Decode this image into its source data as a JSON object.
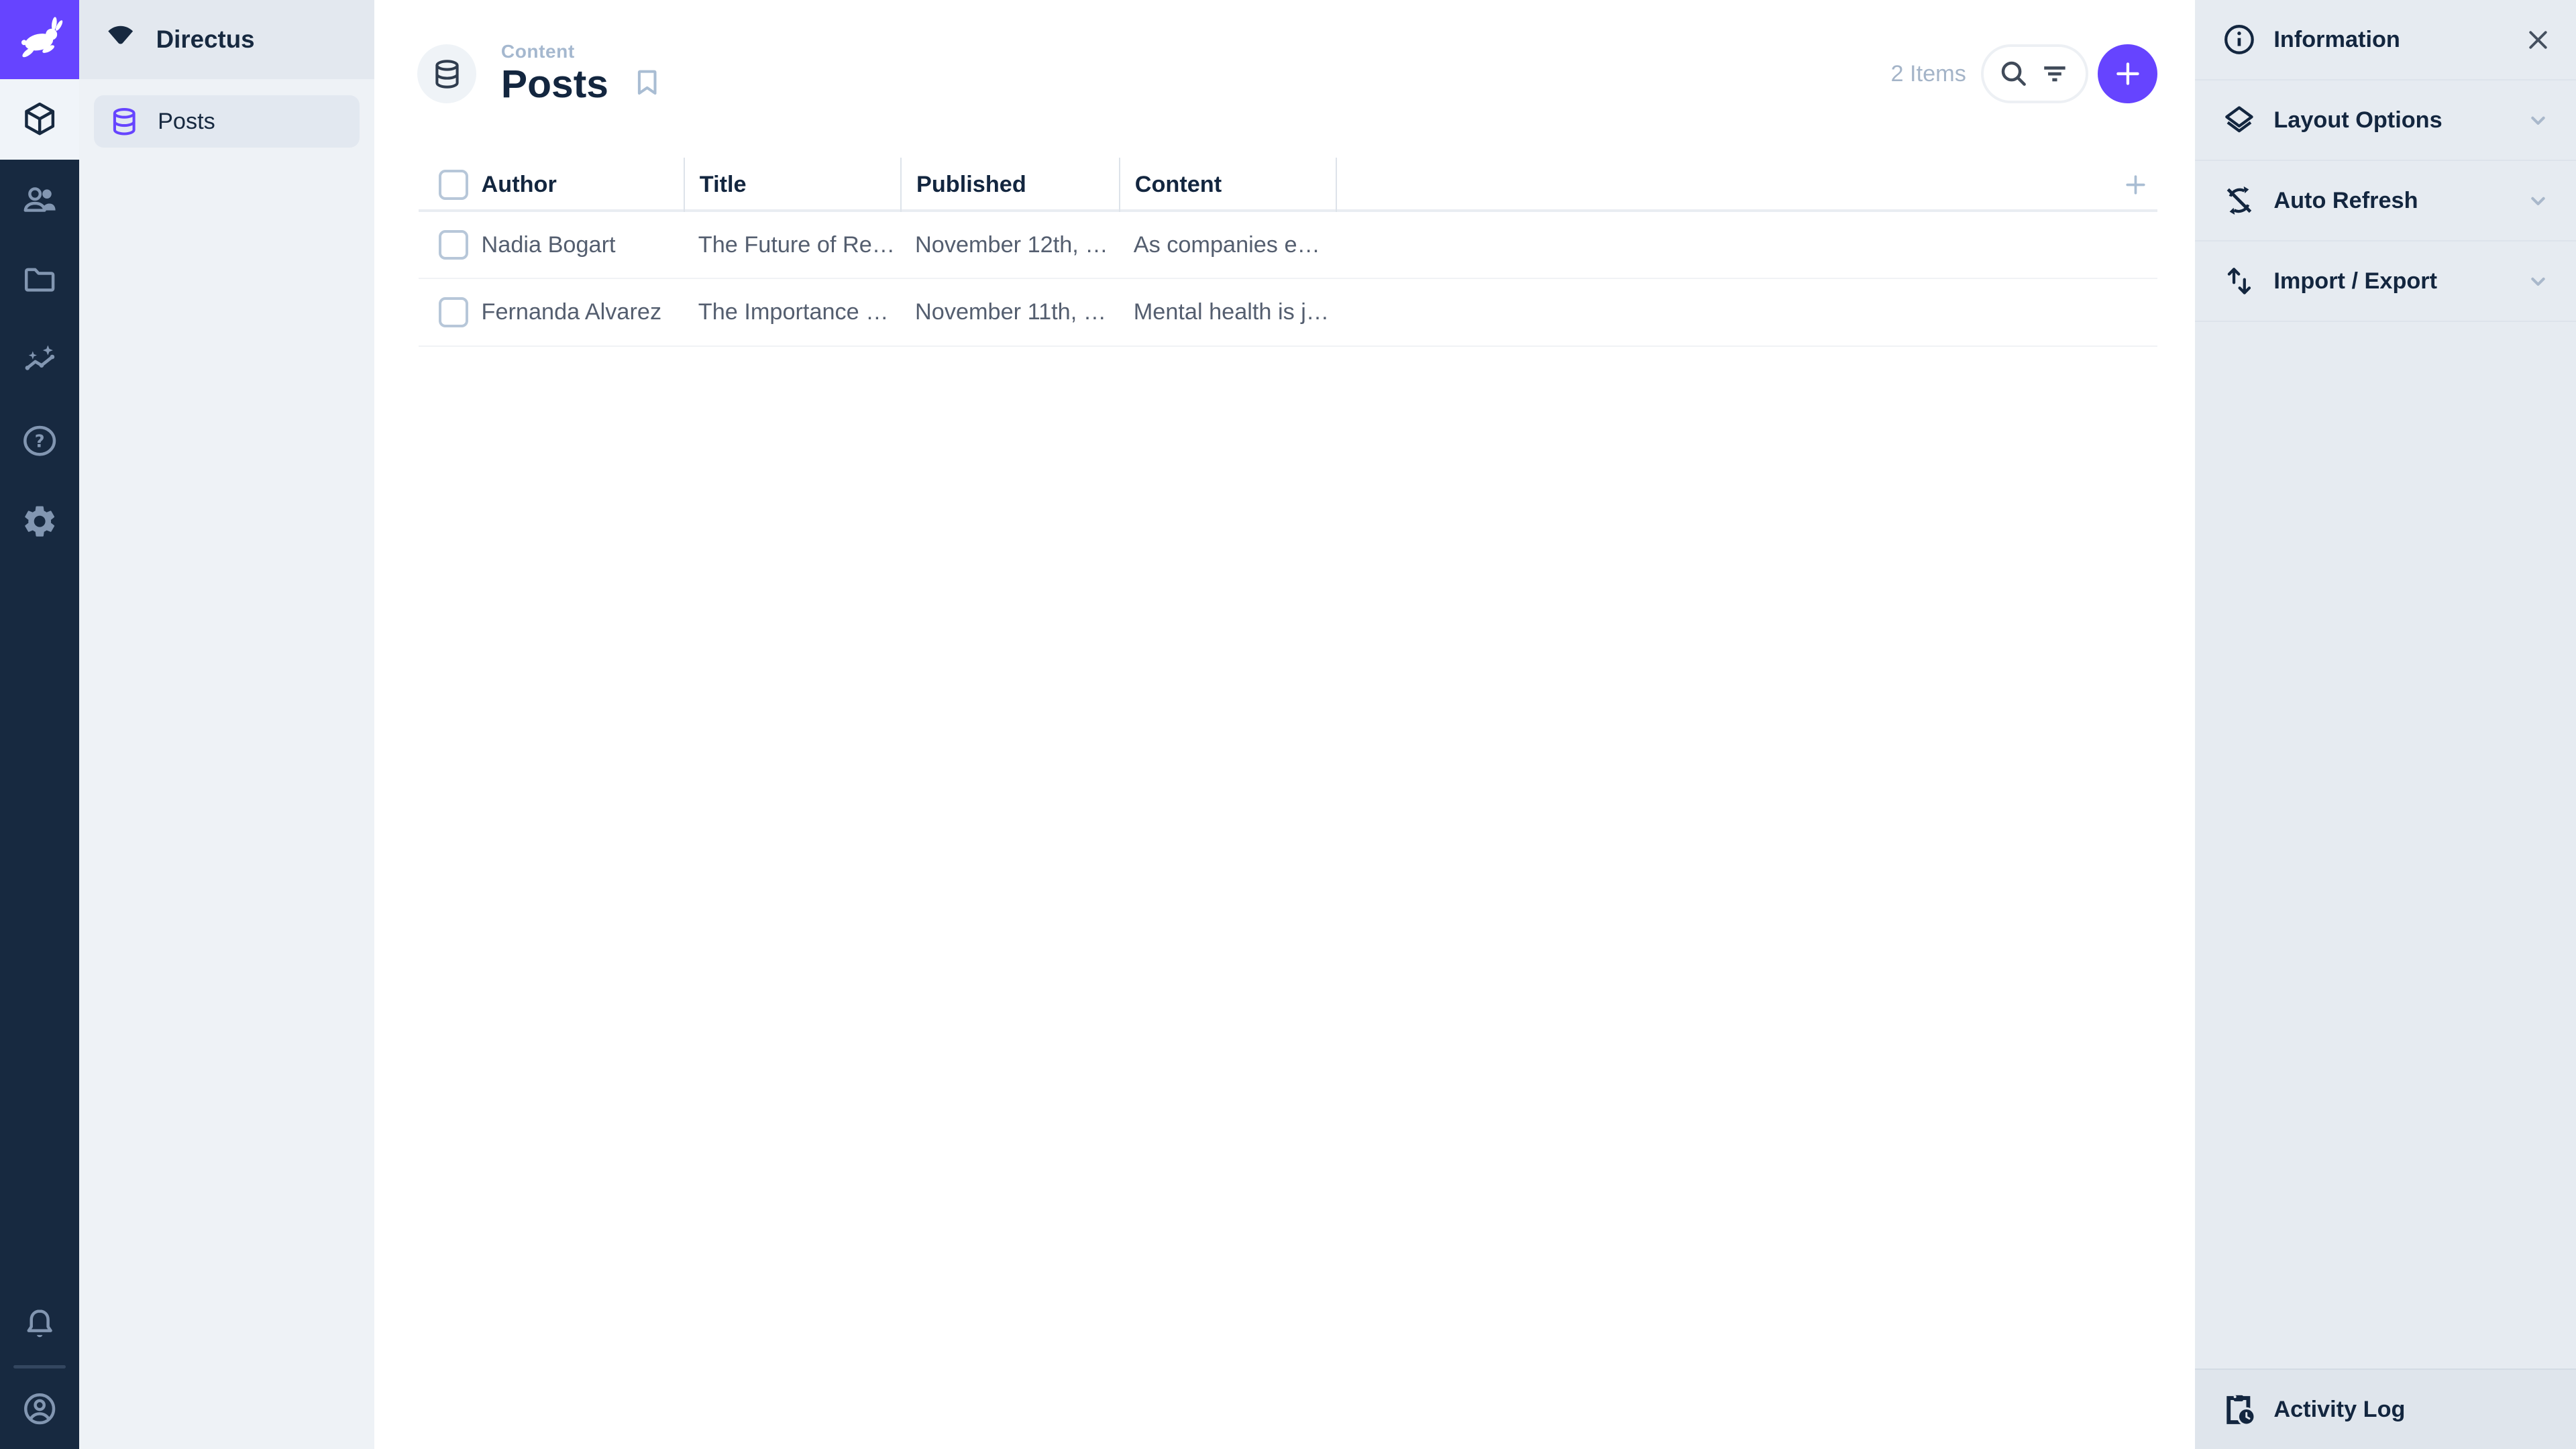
{
  "app": {
    "name": "Directus"
  },
  "colors": {
    "accent": "#6644ff",
    "module_bar_bg": "#172940",
    "module_icon": "#8296b1",
    "sidebar_bg": "#e6ebf1",
    "nav_bg": "#eef2f6",
    "text_primary": "#13263f",
    "text_secondary": "#545e6f",
    "text_subdued": "#a5b8cf"
  },
  "module_bar": {
    "logo_icon": "directus-rabbit-logo",
    "modules": [
      {
        "name": "content",
        "icon": "box-icon",
        "active": true
      },
      {
        "name": "user-directory",
        "icon": "people-icon",
        "active": false
      },
      {
        "name": "file-library",
        "icon": "folder-icon",
        "active": false
      },
      {
        "name": "insights",
        "icon": "insights-icon",
        "active": false
      },
      {
        "name": "documentation",
        "icon": "help-icon",
        "active": false
      },
      {
        "name": "settings",
        "icon": "gear-icon",
        "active": false
      }
    ],
    "bottom": [
      {
        "name": "notifications",
        "icon": "bell-icon"
      },
      {
        "name": "account",
        "icon": "account-circle-icon"
      }
    ]
  },
  "nav": {
    "project_name": "Directus",
    "project_icon": "fan-icon",
    "items": [
      {
        "label": "Posts",
        "icon": "database-icon",
        "active": true
      }
    ]
  },
  "header": {
    "breadcrumb": "Content",
    "title": "Posts",
    "title_icon": "database-icon",
    "bookmark_icon": "bookmark-icon",
    "items_count": "2 Items",
    "search_icon": "search-icon",
    "filter_icon": "filter-icon",
    "add_icon": "plus-icon"
  },
  "table": {
    "columns": [
      "Author",
      "Title",
      "Published",
      "Content"
    ],
    "rows": [
      {
        "author": "Nadia Bogart",
        "title": "The Future of Re…",
        "published": "November 12th, …",
        "content": "As companies e…"
      },
      {
        "author": "Fernanda Alvarez",
        "title": "The Importance …",
        "published": "November 11th, …",
        "content": "Mental health is j…"
      }
    ],
    "add_column_icon": "plus-icon"
  },
  "sidebar": {
    "sections": [
      {
        "label": "Information",
        "icon": "info-icon",
        "action": "close"
      },
      {
        "label": "Layout Options",
        "icon": "layers-icon",
        "action": "expand"
      },
      {
        "label": "Auto Refresh",
        "icon": "sync-disabled-icon",
        "action": "expand"
      },
      {
        "label": "Import / Export",
        "icon": "import-export-icon",
        "action": "expand"
      }
    ],
    "activity_log": {
      "label": "Activity Log",
      "icon": "clipboard-clock-icon"
    }
  }
}
